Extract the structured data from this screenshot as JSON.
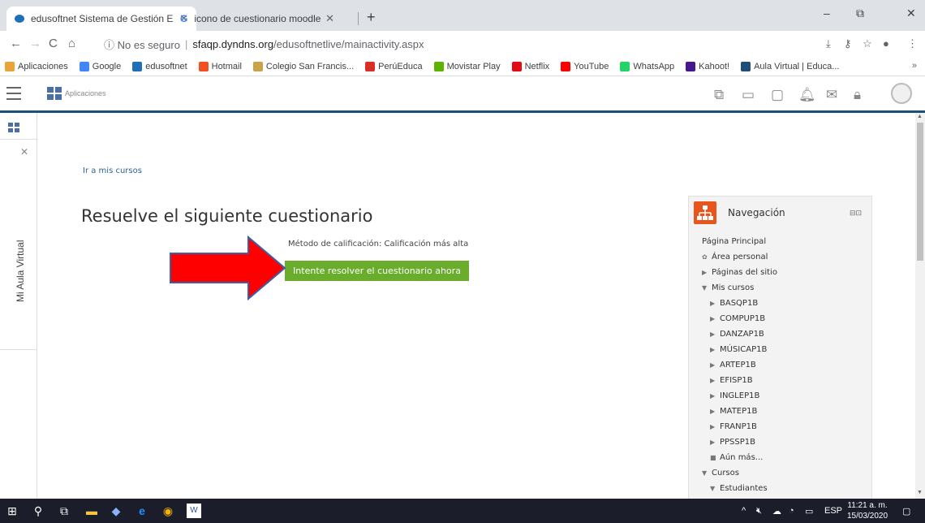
{
  "browser": {
    "tabs": [
      {
        "label": "edusoftnet Sistema de Gestión E",
        "close": "✕"
      },
      {
        "label": "icono de cuestionario moodle - I",
        "close": "✕"
      }
    ],
    "new_tab": "+",
    "window_controls": {
      "minimize": "–",
      "maximize": "⧉",
      "close": "✕"
    },
    "nav": {
      "back": "←",
      "forward": "→",
      "reload": "C",
      "home": "⌂"
    },
    "address": {
      "security_label": "ⓘ No es seguro",
      "separator": "|",
      "host": "sfaqp.dyndns.org",
      "path": "/edusoftnetlive/mainactivity.aspx"
    },
    "bookmarks": [
      {
        "label": "Aplicaciones",
        "color": "#e8a33a"
      },
      {
        "label": "Google",
        "color": "#4285f4"
      },
      {
        "label": "edusoftnet",
        "color": "#1d6fb8"
      },
      {
        "label": "Hotmail",
        "color": "#f25022"
      },
      {
        "label": "Colegio San Francis...",
        "color": "#c9a24a"
      },
      {
        "label": "PerúEduca",
        "color": "#d93025"
      },
      {
        "label": "Movistar Play",
        "color": "#5bb300"
      },
      {
        "label": "Netflix",
        "color": "#e50914"
      },
      {
        "label": "YouTube",
        "color": "#ff0000"
      },
      {
        "label": "WhatsApp",
        "color": "#25d366"
      },
      {
        "label": "Kahoot!",
        "color": "#46178f"
      },
      {
        "label": "Aula Virtual | Educa...",
        "color": "#1f4e79"
      }
    ],
    "bookmarks_more": "»"
  },
  "app_header": {
    "apps_label": "Aplicaciones"
  },
  "sidebar": {
    "vertical_label": "Mi Aula Virtual",
    "close": "✕"
  },
  "main": {
    "link": "Ir a mis cursos",
    "title": "Resuelve el siguiente cuestionario",
    "grading_method": "Método de calificación: Calificación más alta",
    "attempt_button": "Intente resolver el cuestionario ahora"
  },
  "navigation": {
    "title": "Navegación",
    "items": [
      {
        "label": "Página Principal",
        "prefix": ""
      },
      {
        "label": "Área personal",
        "prefix": "✿"
      },
      {
        "label": "Páginas del sitio",
        "prefix": "▶"
      },
      {
        "label": "Mis cursos",
        "prefix": "▼"
      },
      {
        "label": "BASQP1B",
        "prefix": "▶"
      },
      {
        "label": "COMPUP1B",
        "prefix": "▶"
      },
      {
        "label": "DANZAP1B",
        "prefix": "▶"
      },
      {
        "label": "MÚSICAP1B",
        "prefix": "▶"
      },
      {
        "label": "ARTEP1B",
        "prefix": "▶"
      },
      {
        "label": "EFISP1B",
        "prefix": "▶"
      },
      {
        "label": "INGLEP1B",
        "prefix": "▶"
      },
      {
        "label": "MATEP1B",
        "prefix": "▶"
      },
      {
        "label": "FRANP1B",
        "prefix": "▶"
      },
      {
        "label": "PPSSP1B",
        "prefix": "▶"
      },
      {
        "label": "Aún más...",
        "prefix": "■"
      },
      {
        "label": "Cursos",
        "prefix": "▼"
      },
      {
        "label": "Estudiantes",
        "prefix": "▼"
      }
    ]
  },
  "taskbar": {
    "language": "ESP",
    "time": "11:21 a. m.",
    "date": "15/03/2020"
  },
  "colors": {
    "accent_green": "#6aad2c",
    "header_border": "#1f4e79",
    "nav_icon": "#e9561b",
    "arrow_red": "#ff0000",
    "arrow_border": "#3a5fa8"
  }
}
